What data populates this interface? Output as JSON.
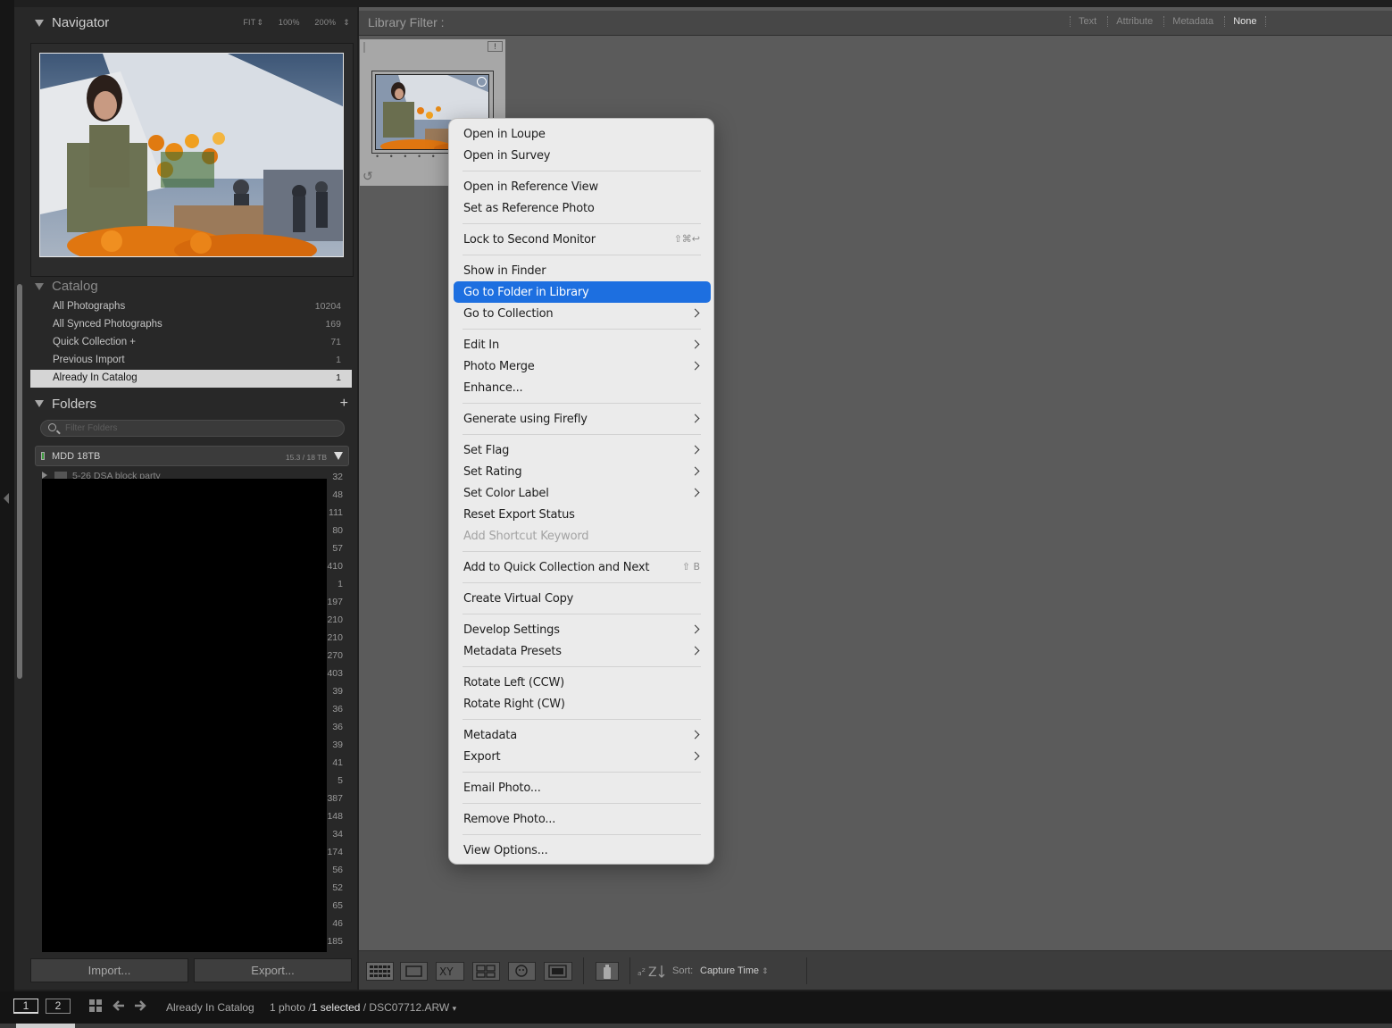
{
  "navigator": {
    "title": "Navigator",
    "zoom_options": [
      "FIT",
      "100%",
      "200%"
    ]
  },
  "catalog": {
    "title": "Catalog",
    "items": [
      {
        "label": "All Photographs",
        "count": "10204"
      },
      {
        "label": "All Synced Photographs",
        "count": "169"
      },
      {
        "label": "Quick Collection +",
        "count": "71"
      },
      {
        "label": "Previous Import",
        "count": "1"
      },
      {
        "label": "Already In Catalog",
        "count": "1",
        "selected": true
      }
    ]
  },
  "folders": {
    "title": "Folders",
    "add_label": "+",
    "search_placeholder": "Filter Folders",
    "volume": {
      "name": "MDD 18TB",
      "size": "15.3 / 18 TB"
    },
    "partial_folder": "5-26 DSA block party",
    "counts": [
      "32",
      "48",
      "111",
      "80",
      "57",
      "410",
      "1",
      "197",
      "210",
      "210",
      "270",
      "403",
      "39",
      "36",
      "36",
      "39",
      "41",
      "5",
      "387",
      "148",
      "34",
      "174",
      "56",
      "52",
      "65",
      "46",
      "185"
    ]
  },
  "left_buttons": {
    "import": "Import...",
    "export": "Export..."
  },
  "library_filter": {
    "title": "Library Filter :",
    "options": [
      "Text",
      "Attribute",
      "Metadata",
      "None"
    ],
    "active": "None"
  },
  "grid_cell": {
    "badge": "!",
    "dots": "• • • • •"
  },
  "toolbar": {
    "sort_label": "Sort:",
    "sort_value": "Capture Time"
  },
  "status": {
    "monitor1": "1",
    "monitor2": "2",
    "source": "Already In Catalog",
    "count_prefix": "1 photo /",
    "selected": "1 selected",
    "filename": "/ DSC07712.ARW"
  },
  "context_menu": {
    "items": [
      {
        "label": "Open in Loupe"
      },
      {
        "label": "Open in Survey"
      },
      {
        "label": "Open in Reference View"
      },
      {
        "label": "Set as Reference Photo"
      },
      {
        "label": "Lock to Second Monitor",
        "shortcut": "⇧⌘↩"
      },
      {
        "label": "Show in Finder"
      },
      {
        "label": "Go to Folder in Library",
        "highlighted": true
      },
      {
        "label": "Go to Collection",
        "submenu": true
      },
      {
        "label": "Edit In",
        "submenu": true
      },
      {
        "label": "Photo Merge",
        "submenu": true
      },
      {
        "label": "Enhance..."
      },
      {
        "label": "Generate using Firefly",
        "submenu": true
      },
      {
        "label": "Set Flag",
        "submenu": true
      },
      {
        "label": "Set Rating",
        "submenu": true
      },
      {
        "label": "Set Color Label",
        "submenu": true
      },
      {
        "label": "Reset Export Status"
      },
      {
        "label": "Add Shortcut Keyword",
        "disabled": true
      },
      {
        "label": "Add to Quick Collection and Next",
        "shortcut": "⇧ B"
      },
      {
        "label": "Create Virtual Copy"
      },
      {
        "label": "Develop Settings",
        "submenu": true
      },
      {
        "label": "Metadata Presets",
        "submenu": true
      },
      {
        "label": "Rotate Left (CCW)"
      },
      {
        "label": "Rotate Right (CW)"
      },
      {
        "label": "Metadata",
        "submenu": true
      },
      {
        "label": "Export",
        "submenu": true
      },
      {
        "label": "Email Photo..."
      },
      {
        "label": "Remove Photo..."
      },
      {
        "label": "View Options..."
      }
    ]
  }
}
